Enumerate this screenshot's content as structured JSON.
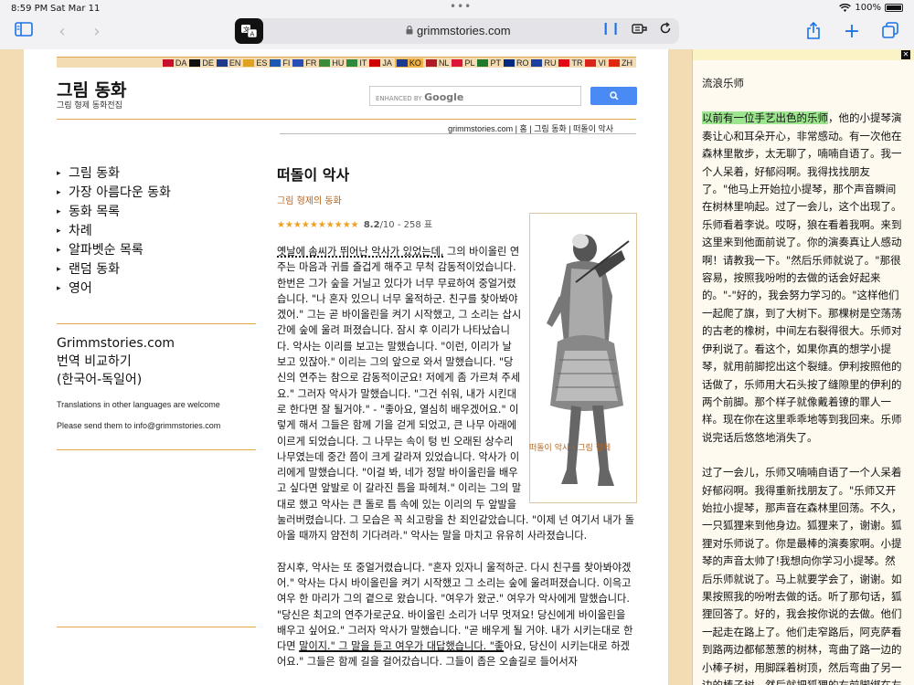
{
  "status": {
    "time": "8:59 PM",
    "date": "Sat Mar 11",
    "battery": "100%"
  },
  "browser": {
    "url": "grimmstories.com",
    "translate_icon": "translate-icon"
  },
  "languages": [
    {
      "code": "DA",
      "color": "#c8102e"
    },
    {
      "code": "DE",
      "color": "#111111"
    },
    {
      "code": "EN",
      "color": "#1f3a8a"
    },
    {
      "code": "ES",
      "color": "#e0a020"
    },
    {
      "code": "FI",
      "color": "#1e56b4"
    },
    {
      "code": "FR",
      "color": "#2a4db5"
    },
    {
      "code": "HU",
      "color": "#3c8a3c"
    },
    {
      "code": "IT",
      "color": "#2d8a3e"
    },
    {
      "code": "JA",
      "color": "#d00000"
    },
    {
      "code": "KO",
      "color": "#1c3b8f",
      "active": true
    },
    {
      "code": "NL",
      "color": "#ae1c28"
    },
    {
      "code": "PL",
      "color": "#dc143c"
    },
    {
      "code": "PT",
      "color": "#1e7b2e"
    },
    {
      "code": "RO",
      "color": "#002b7f"
    },
    {
      "code": "RU",
      "color": "#1c3fa0"
    },
    {
      "code": "TR",
      "color": "#e30a17"
    },
    {
      "code": "VI",
      "color": "#da251d"
    },
    {
      "code": "ZH",
      "color": "#de2910"
    }
  ],
  "site": {
    "title": "그림 동화",
    "subtitle": "그림 형제 동화전집",
    "search_enhanced": "ENHANCED BY",
    "search_brand": "Google",
    "breadcrumb": "grimmstories.com | 홈 | 그림 동화 | 떠돌이 악사"
  },
  "sidebar": {
    "items": [
      "그림 동화",
      "가장 아름다운 동화",
      "동화 목록",
      "차례",
      "알파벳순 목록",
      "랜덤 동화",
      "영어"
    ],
    "compare_title": "Grimmstories.com",
    "compare_line2": "번역 비교하기",
    "compare_line3": "(한국어-독일어)",
    "note1": "Translations in other languages are welcome",
    "note2": "Please send them to info@grimmstories.com"
  },
  "story": {
    "title": "떠돌이 악사",
    "author": "그림 형제의 동화",
    "stars": "★★★★★★★★★★",
    "rating_value": "8.2",
    "rating_suffix": "/10 - 258 표",
    "illustration_caption": "떠돌이 악사 - 그림 형제",
    "p1_first": "옛날에 솜씨가 뛰어난 악사가 있었는데,",
    "p1_rest": " 그의 바이올린 연주는 마음과 귀를 즐겁게 해주고 무척 감동적이었습니다. 한번은 그가 숲을 거닐고 있다가 너무 무료하여 중얼거렸습니다. \"나 혼자 있으니 너무 울적하군. 친구를 찾아봐야겠어.\" 그는 곧 바이올린을 켜기 시작했고, 그 소리는 삽시간에 숲에 울려 퍼졌습니다. 잠시 후 이리가 나타났습니다. 악사는 이리를 보고는 말했습니다. \"이런, 이리가 날 보고 있잖아.\" 이리는 그의 앞으로 와서 말했습니다. \"당신의 연주는 참으로 감동적이군요! 저에게 좀 가르쳐 주세요.\" 그러자 악사가 말했습니다. \"그건 쉬워, 내가 시킨대로 한다면 잘 될거야.\" - \"좋아요, 열심히 배우겠어요.\" 이렇게 해서 그들은 함께 기을 걷게 되었고, 큰 나무 아래에 이르게 되었습니다. 그 나무는 속이 텅 빈 오래된 상수리나무였는데 중간 쯤이 크게 갈라져 있었습니다. 악사가 이리에게 말했습니다. \"이걸 봐, 네가 정말 바이올린을 배우고 싶다면 앞발로 이 갈라진 틈을 파헤쳐.\" 이리는 그의 말대로 했고 악사는 큰 돌로 틈 속에 있는 이리의 두 앞발을 눌러버렸습니다. 그 모습은 꼭 쇠고랑을 찬 죄인같았습니다. \"이제 넌 여기서 내가 돌아올 때까지 얌전히 기다려라.\" 악사는 말을 마치고 유유히 사라졌습니다.",
    "p2_a": "잠시후, 악사는 또 중얼거렸습니다. \"혼자 있자니 울적하군. 다시 친구를 찾아봐야겠어.\" 악사는 다시 바이올린을 켜기 시작했고 그 소리는 숲에 울려퍼졌습니다. 이윽고 여우 한 마리가 그의 곁으로 왔습니다. \"여우가 왔군.\" 여우가 악사에게 말했습니다. \"당신은 최고의 연주가로군요. 바이올린 소리가 너무 멋져요! 당신에게 바이올린을 배우고 싶어요.\" 그러자 악사가 말했습니다. \"곧 배우게 될 거야. 내가 시키는대로 한다면 ",
    "p2_cursor": "말이지.\" 그 말을 듣고 여우가 대답했습니다. \"좋",
    "p2_b": "아요, 당신이 시키는대로 하겠어요.\" 그들은 함께 길을 걸어갔습니다. 그들이 좁은 오솔길로 들어서자"
  },
  "panel": {
    "title": "流浪乐师",
    "p1_highlight": "以前有一位手艺出色的乐师",
    "p1_rest": "，他的小提琴演奏让心和耳朵开心，非常感动。有一次他在森林里散步，太无聊了，喃喃自语了。我一个人呆着，好郁闷啊。我得找找朋友了。\"他马上开始拉小提琴，那个声音瞬间在树林里响起。过了一会儿，这个出现了。乐师看着李说。哎呀，狼在看着我啊。来到这里来到他面前说了。你的演奏真让人感动啊！请教我一下。\"然后乐师就说了。\"那很容易，按照我吩咐的去做的话会好起来的。\"-\"好的，我会努力学习的。\"这样他们一起爬了旗，到了大树下。那棵树是空荡荡的古老的橡树，中间左右裂得很大。乐师对伊利说了。看这个，如果你真的想学小提琴，就用前脚挖出这个裂缝。伊利按照他的话做了，乐师用大石头按了缝隙里的伊利的两个前脚。那个样子就像戴着镣的罪人一样。现在你在这里乖乖地等到我回来。乐师说完话后悠悠地消失了。",
    "p2": "过了一会儿，乐师又喃喃自语了一个人呆着好郁闷啊。我得重新找朋友了。\"乐师又开始拉小提琴，那声音在森林里回荡。不久，一只狐狸来到他身边。狐狸来了，谢谢。狐狸对乐师说了。你是最棒的演奏家啊。小提琴的声音太帅了!我想向你学习小提琴。然后乐师就说了。马上就要学会了，谢谢。如果按照我的吩咐去做的话。听了那句话，狐狸回答了。好的，我会按你说的去做。他们一起走在路上了。他们走窄路后，阿克萨看到路两边都郁葱葱的树林，弯曲了路一边的小棒子树，用脚踩着树顶，然后弯曲了另一边的棒子树。然后就把狐狸的右前脚绑在左边的棒子上"
  }
}
